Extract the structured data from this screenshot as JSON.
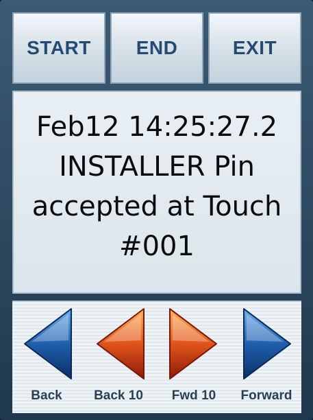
{
  "top_buttons": {
    "start_label": "START",
    "end_label": "END",
    "exit_label": "EXIT"
  },
  "display": {
    "lines": [
      "Feb12 14:25:27.2",
      "INSTALLER Pin",
      "accepted at Touch",
      "#001"
    ]
  },
  "navigation": {
    "back_label": "Back",
    "back10_label": "Back 10",
    "fwd10_label": "Fwd 10",
    "forward_label": "Forward",
    "back_icon": "blue-left-arrow-icon",
    "back10_icon": "orange-left-arrow-icon",
    "fwd10_icon": "orange-right-arrow-icon",
    "forward_icon": "blue-right-arrow-icon"
  },
  "colors": {
    "button_text": "#244a72",
    "blue_arrow": "#1f5fae",
    "orange_arrow": "#e0541a"
  }
}
